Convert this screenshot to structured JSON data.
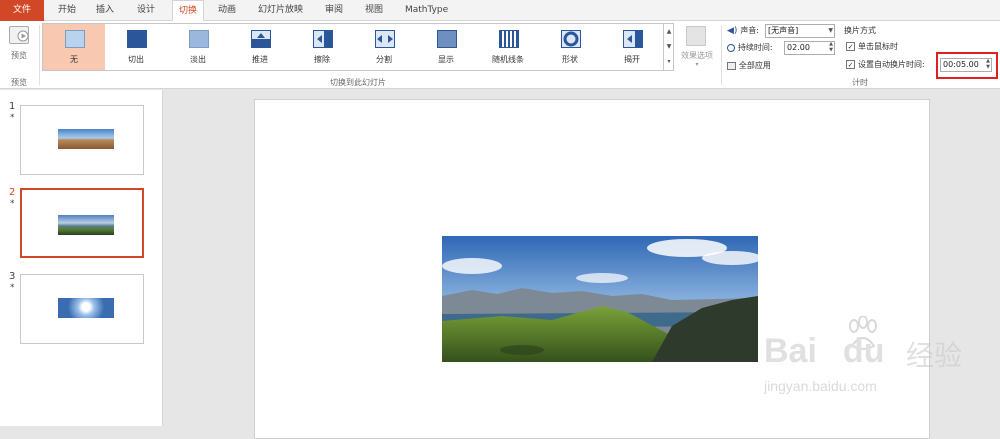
{
  "tabs": {
    "file": "文件",
    "home": "开始",
    "insert": "插入",
    "design": "设计",
    "transitions": "切换",
    "animations": "动画",
    "slideshow": "幻灯片放映",
    "review": "审阅",
    "view": "视图",
    "mathtype": "MathType"
  },
  "preview": {
    "button": "预览",
    "group": "预览"
  },
  "transitions": {
    "items": [
      "无",
      "切出",
      "淡出",
      "推进",
      "擦除",
      "分割",
      "显示",
      "随机线条",
      "形状",
      "揭开"
    ],
    "group": "切换到此幻灯片",
    "effect_options": "效果选项"
  },
  "timing": {
    "sound_label": "声音:",
    "sound_value": "[无声音]",
    "duration_label": "持续时间:",
    "duration_value": "02.00",
    "apply_all": "全部应用",
    "advance_title": "换片方式",
    "on_click": "单击鼠标时",
    "after_label": "设置自动换片时间:",
    "after_value": "00:05.00",
    "group": "计时"
  },
  "slides": [
    {
      "num": "1",
      "star": "*"
    },
    {
      "num": "2",
      "star": "*"
    },
    {
      "num": "3",
      "star": "*"
    }
  ],
  "watermark": {
    "brand": "Bai",
    "brand2": "du",
    "cn": "经验",
    "url": "jingyan.baidu.com"
  },
  "colors": {
    "accent": "#d24726",
    "highlight": "#e02020"
  }
}
